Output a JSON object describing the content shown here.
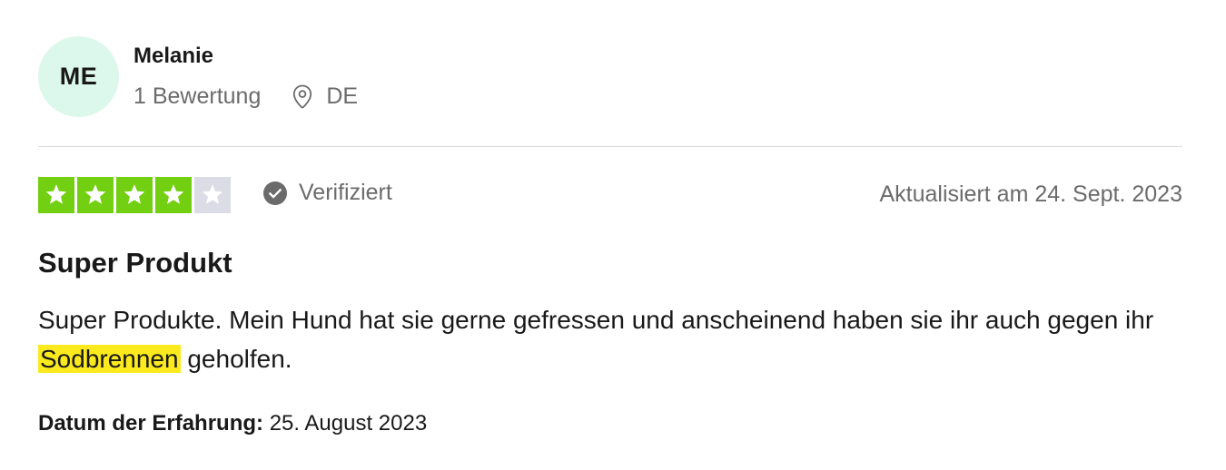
{
  "reviewer": {
    "initials": "ME",
    "name": "Melanie",
    "review_count": "1 Bewertung",
    "country": "DE",
    "avatar_color": "#dcf7ec"
  },
  "review": {
    "rating": 4,
    "max_rating": 5,
    "star_filled_color": "#73cf11",
    "star_empty_color": "#dcdce6",
    "verified_label": "Verifiziert",
    "updated": "Aktualisiert am 24. Sept. 2023",
    "title": "Super Produkt",
    "body_before": "Super Produkte. Mein Hund hat sie gerne gefressen und anscheinend haben sie ihr auch gegen ihr ",
    "body_highlight": "Sodbrennen",
    "body_after": " geholfen.",
    "highlight_color": "#fcea1e",
    "experience_label": "Datum der Erfahrung:",
    "experience_date": "25. August 2023"
  },
  "icons": {
    "location": "location-pin-icon",
    "verified": "check-circle-icon",
    "star": "star-icon"
  }
}
